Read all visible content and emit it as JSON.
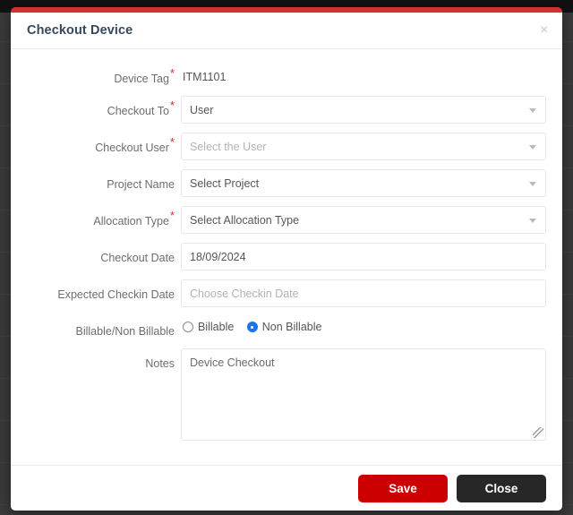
{
  "backdrop": {
    "color": "#3a3a3a"
  },
  "modal": {
    "title": "Checkout Device",
    "accent_color": "#d32f2f",
    "close_icon": "×",
    "required_marker": "*"
  },
  "form": {
    "rows": [
      {
        "label": "Device Tag",
        "required": true,
        "type": "static",
        "value": "ITM1101"
      },
      {
        "label": "Checkout To",
        "required": true,
        "type": "select",
        "value": "User",
        "filled": true
      },
      {
        "label": "Checkout User",
        "required": true,
        "type": "select",
        "value": "Select the User",
        "filled": false
      },
      {
        "label": "Project Name",
        "required": false,
        "type": "select",
        "value": "Select Project",
        "filled": true
      },
      {
        "label": "Allocation Type",
        "required": true,
        "type": "select",
        "value": "Select Allocation Type",
        "filled": true
      },
      {
        "label": "Checkout Date",
        "required": false,
        "type": "text",
        "value": "18/09/2024",
        "filled": true
      },
      {
        "label": "Expected Checkin Date",
        "required": false,
        "type": "text",
        "value": "Choose Checkin Date",
        "filled": false
      },
      {
        "label": "Billable/Non Billable",
        "required": false,
        "type": "radio"
      },
      {
        "label": "Notes",
        "required": false,
        "type": "textarea",
        "value": "Device Checkout"
      }
    ],
    "radio_options": [
      {
        "label": "Billable",
        "selected": false
      },
      {
        "label": "Non Billable",
        "selected": true
      }
    ]
  },
  "footer": {
    "save_label": "Save",
    "close_label": "Close",
    "save_color": "#cc0000",
    "close_color": "#272727"
  }
}
